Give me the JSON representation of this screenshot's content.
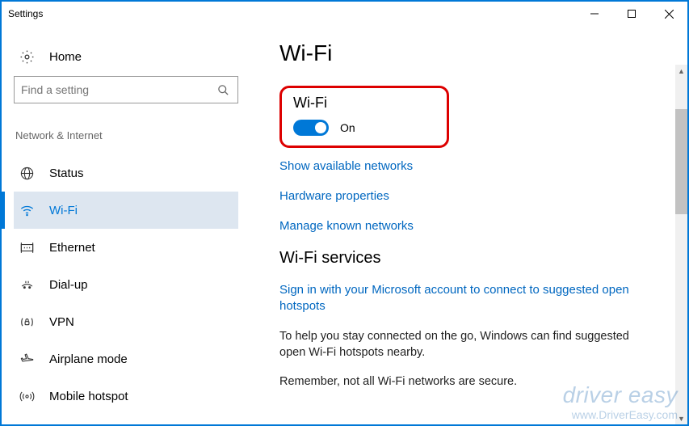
{
  "window": {
    "title": "Settings"
  },
  "sidebar": {
    "home_label": "Home",
    "search_placeholder": "Find a setting",
    "category": "Network & Internet",
    "items": [
      {
        "label": "Status",
        "icon": "globe-icon"
      },
      {
        "label": "Wi-Fi",
        "icon": "wifi-icon",
        "active": true
      },
      {
        "label": "Ethernet",
        "icon": "ethernet-icon"
      },
      {
        "label": "Dial-up",
        "icon": "dialup-icon"
      },
      {
        "label": "VPN",
        "icon": "vpn-icon"
      },
      {
        "label": "Airplane mode",
        "icon": "airplane-icon"
      },
      {
        "label": "Mobile hotspot",
        "icon": "hotspot-icon"
      }
    ]
  },
  "main": {
    "title": "Wi-Fi",
    "wifi_heading": "Wi-Fi",
    "toggle_state": "On",
    "links": {
      "show_networks": "Show available networks",
      "hardware_props": "Hardware properties",
      "manage_known": "Manage known networks"
    },
    "services_heading": "Wi-Fi services",
    "signin_link": "Sign in with your Microsoft account to connect to suggested open hotspots",
    "help_text": "To help you stay connected on the go, Windows can find suggested open Wi-Fi hotspots nearby.",
    "remember_text": "Remember, not all Wi-Fi networks are secure."
  },
  "watermark": {
    "brand": "driver easy",
    "url": "www.DriverEasy.com"
  }
}
